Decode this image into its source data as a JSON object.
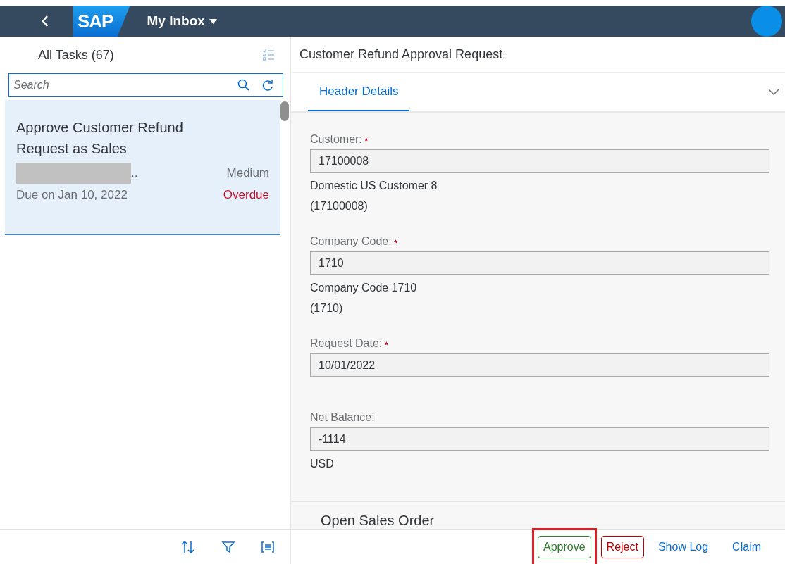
{
  "shell": {
    "logo": "SAP",
    "title": "My Inbox"
  },
  "master": {
    "title": "All Tasks (67)",
    "search": {
      "placeholder": "Search"
    },
    "tasks": [
      {
        "title": "Approve Customer Refund Request as Sales",
        "creator_suffix": "..",
        "priority": "Medium",
        "due": "Due on Jan 10, 2022",
        "status": "Overdue",
        "selected": true
      }
    ]
  },
  "detail": {
    "title": "Customer Refund Approval Request",
    "tabs": [
      {
        "label": "Header Details",
        "selected": true
      }
    ],
    "fields": [
      {
        "label": "Customer:",
        "required": true,
        "value": "17100008",
        "description": [
          "Domestic US Customer 8",
          "(17100008)"
        ]
      },
      {
        "label": "Company Code:",
        "required": true,
        "value": "1710",
        "description": [
          "Company Code 1710",
          "(1710)"
        ]
      },
      {
        "label": "Request Date:",
        "required": true,
        "value": "10/01/2022"
      },
      {
        "label": "Net Balance:",
        "required": false,
        "value": "-1114",
        "description": [
          "USD"
        ]
      }
    ],
    "section_title": "Open Sales Order",
    "actions": [
      {
        "label": "Approve",
        "kind": "accept",
        "highlighted": true
      },
      {
        "label": "Reject",
        "kind": "reject",
        "highlighted": false
      },
      {
        "label": "Show Log",
        "kind": "link",
        "highlighted": false
      },
      {
        "label": "Claim",
        "kind": "link",
        "highlighted": false
      }
    ]
  }
}
